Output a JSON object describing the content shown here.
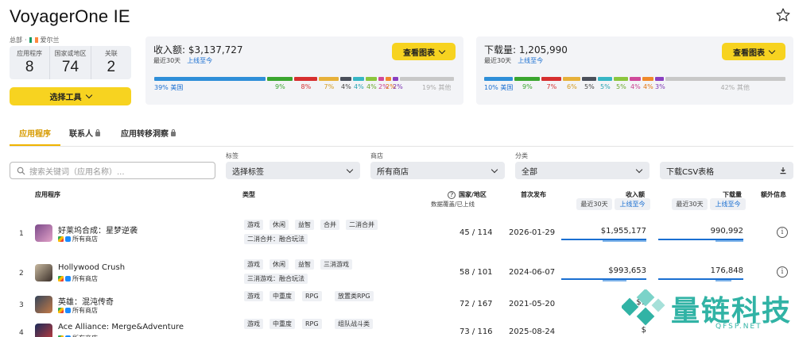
{
  "app": {
    "title": "VoyagerOne IE",
    "breadcrumb_prefix": "总部",
    "breadcrumb_sep": "·",
    "region": "爱尔兰"
  },
  "stats": [
    {
      "label": "应用程序",
      "value": "8"
    },
    {
      "label": "国家或地区",
      "value": "74"
    },
    {
      "label": "关联",
      "value": "2"
    }
  ],
  "select_tool_label": "选择工具",
  "revenue": {
    "title": "收入额: $3,137,727",
    "links": [
      "最近30天",
      "上线至今"
    ],
    "chart_button": "查看图表",
    "segments": [
      {
        "pct": 39,
        "color": "#2f8fd8",
        "label": "39% 美国",
        "text_color": "#1a6fd1"
      },
      {
        "pct": 9,
        "color": "#3aa52f",
        "label": "9%",
        "text_color": "#3aa52f"
      },
      {
        "pct": 8,
        "color": "#d62f2f",
        "label": "8%",
        "text_color": "#d62f2f"
      },
      {
        "pct": 7,
        "color": "#e7b13a",
        "label": "7%",
        "text_color": "#d49a1b"
      },
      {
        "pct": 4,
        "color": "#4a4f5a",
        "label": "4%",
        "text_color": "#444444"
      },
      {
        "pct": 4,
        "color": "#37b6c5",
        "label": "4%",
        "text_color": "#26a3b2"
      },
      {
        "pct": 4,
        "color": "#8cc63e",
        "label": "4%",
        "text_color": "#6aa82a"
      },
      {
        "pct": 2,
        "color": "#d04a9a",
        "label": "2%",
        "text_color": "#c93e8e"
      },
      {
        "pct": 2,
        "color": "#f08a2c",
        "label": "2%",
        "text_color": "#e37612"
      },
      {
        "pct": 2,
        "color": "#8a3fc0",
        "label": "2%",
        "text_color": "#7d35b3"
      },
      {
        "pct": 19,
        "color": "#c8c8c8",
        "label": "19% 其他",
        "text_color": "#aaaaaa"
      }
    ]
  },
  "downloads": {
    "title": "下载量: 1,205,990",
    "links": [
      "最近30天",
      "上线至今"
    ],
    "chart_button": "查看图表",
    "segments": [
      {
        "pct": 10,
        "color": "#2f8fd8",
        "label": "10% 美国",
        "text_color": "#1a6fd1"
      },
      {
        "pct": 9,
        "color": "#3aa52f",
        "label": "9%",
        "text_color": "#3aa52f"
      },
      {
        "pct": 7,
        "color": "#d62f2f",
        "label": "7%",
        "text_color": "#d62f2f"
      },
      {
        "pct": 6,
        "color": "#e7b13a",
        "label": "6%",
        "text_color": "#d49a1b"
      },
      {
        "pct": 5,
        "color": "#4a4f5a",
        "label": "5%",
        "text_color": "#444444"
      },
      {
        "pct": 5,
        "color": "#37b6c5",
        "label": "5%",
        "text_color": "#26a3b2"
      },
      {
        "pct": 5,
        "color": "#8cc63e",
        "label": "5%",
        "text_color": "#6aa82a"
      },
      {
        "pct": 4,
        "color": "#d04a9a",
        "label": "4%",
        "text_color": "#c93e8e"
      },
      {
        "pct": 4,
        "color": "#f08a2c",
        "label": "4%",
        "text_color": "#e37612"
      },
      {
        "pct": 3,
        "color": "#8a3fc0",
        "label": "3%",
        "text_color": "#7d35b3"
      },
      {
        "pct": 42,
        "color": "#c8c8c8",
        "label": "42% 其他",
        "text_color": "#aaaaaa"
      }
    ]
  },
  "tabs": [
    "应用程序",
    "联系人",
    "应用转移洞察"
  ],
  "filters": {
    "search_placeholder": "搜索关键词（应用名称）...",
    "tag_label": "标签",
    "tag_value": "选择标签",
    "store_label": "商店",
    "store_value": "所有商店",
    "category_label": "分类",
    "category_value": "全部",
    "csv_label": "下载CSV表格"
  },
  "table": {
    "headers": {
      "app": "应用程序",
      "type": "类型",
      "countries": "国家/地区",
      "countries_sub": "数据覆盖/已上线",
      "first_release": "首次发布",
      "revenue": "收入额",
      "downloads": "下载量",
      "extra": "额外信息"
    },
    "sub_buttons": [
      "最近30天",
      "上线至今"
    ],
    "platform_label": "所有商店",
    "rows": [
      {
        "rank": "1",
        "name": "好莱坞合成：星梦逆袭",
        "tags": [
          "游戏",
          "休闲",
          "益智",
          "合并",
          "二消合并"
        ],
        "tags2": [
          "二消合并：融合玩法"
        ],
        "countries": "45 / 114",
        "date": "2026-01-29",
        "revenue": "$1,955,177",
        "downloads": "990,992"
      },
      {
        "rank": "2",
        "name": "Hollywood Crush",
        "tags": [
          "游戏",
          "休闲",
          "益智",
          "三消游戏"
        ],
        "tags2": [
          "三消游戏：融合玩法"
        ],
        "countries": "58 / 101",
        "date": "2024-06-07",
        "revenue": "$993,653",
        "downloads": "176,848"
      },
      {
        "rank": "3",
        "name": "英雄：混沌传奇",
        "tags": [
          "游戏",
          "中重度",
          "RPG",
          "放置类RPG"
        ],
        "tags2": [],
        "countries": "72 / 167",
        "date": "2021-05-20",
        "revenue": "$1",
        "downloads": ""
      },
      {
        "rank": "4",
        "name": "Ace Alliance: Merge&Adventure",
        "tags": [
          "游戏",
          "中重度",
          "RPG",
          "组队战斗类"
        ],
        "tags2": [],
        "countries": "73 / 116",
        "date": "2025-08-24",
        "revenue": "$",
        "downloads": ""
      }
    ]
  },
  "watermark": {
    "text": "量链科技",
    "url": "QFSP.NET"
  }
}
